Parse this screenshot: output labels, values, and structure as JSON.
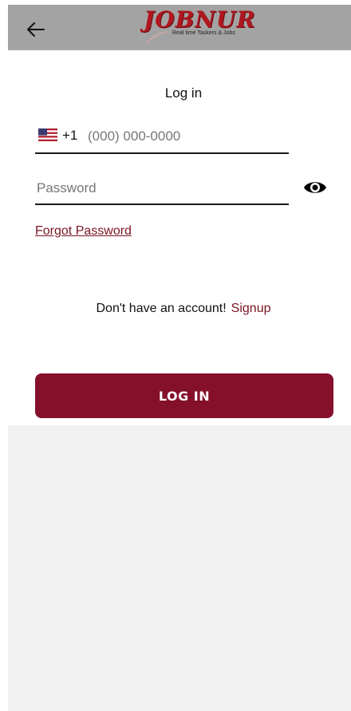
{
  "appbar": {
    "back_icon": "arrow-left-icon",
    "logo_title": "JOBNUR",
    "logo_tagline": "Real time Taskers & Jobs"
  },
  "login": {
    "title": "Log in",
    "phone": {
      "flag_icon": "us-flag-icon",
      "dial_code": "+1",
      "placeholder": "(000) 000-0000",
      "value": ""
    },
    "password": {
      "placeholder": "Password",
      "value": "",
      "toggle_icon": "eye-icon"
    },
    "forgot_label": "Forgot Password",
    "signup_prompt": "Don't have an account!",
    "signup_label": "Signup",
    "submit_label": "LOG IN"
  },
  "colors": {
    "brand": "#85102a",
    "link": "#7a1420",
    "appbar_bg": "#a3a3a3"
  }
}
